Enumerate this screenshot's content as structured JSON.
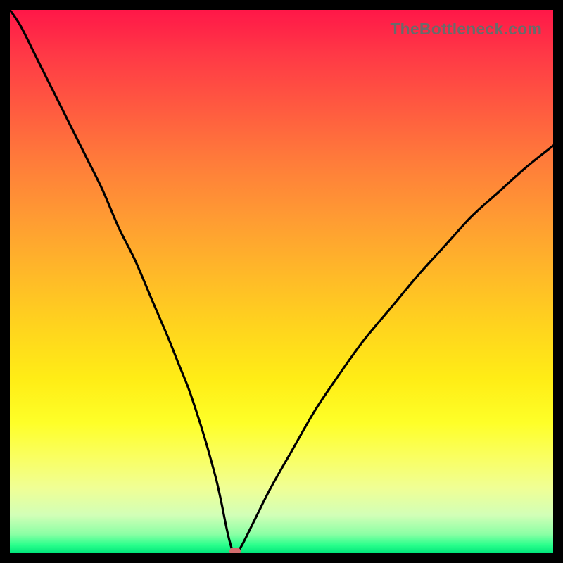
{
  "watermark": "TheBottleneck.com",
  "colors": {
    "background": "#000000",
    "curve": "#000000",
    "marker": "#d36d6e"
  },
  "chart_data": {
    "type": "line",
    "title": "",
    "xlabel": "",
    "ylabel": "",
    "xlim": [
      0,
      100
    ],
    "ylim": [
      0,
      100
    ],
    "x": [
      0,
      2,
      5,
      8,
      11,
      14,
      17,
      20,
      23,
      26,
      29,
      31,
      33,
      35,
      36.5,
      38,
      39,
      39.8,
      40.5,
      41,
      41.5,
      42,
      43,
      45,
      48,
      52,
      56,
      60,
      65,
      70,
      75,
      80,
      85,
      90,
      95,
      100
    ],
    "values": [
      100,
      97,
      91,
      85,
      79,
      73,
      67,
      60,
      54,
      47,
      40,
      35,
      30,
      24,
      19,
      13.5,
      9,
      5,
      2,
      0.5,
      0,
      0.3,
      2,
      6,
      12,
      19,
      26,
      32,
      39,
      45,
      51,
      56.5,
      62,
      66.5,
      71,
      75
    ],
    "marker": {
      "x": 41.5,
      "y": 0
    },
    "grid": false,
    "legend": false
  }
}
